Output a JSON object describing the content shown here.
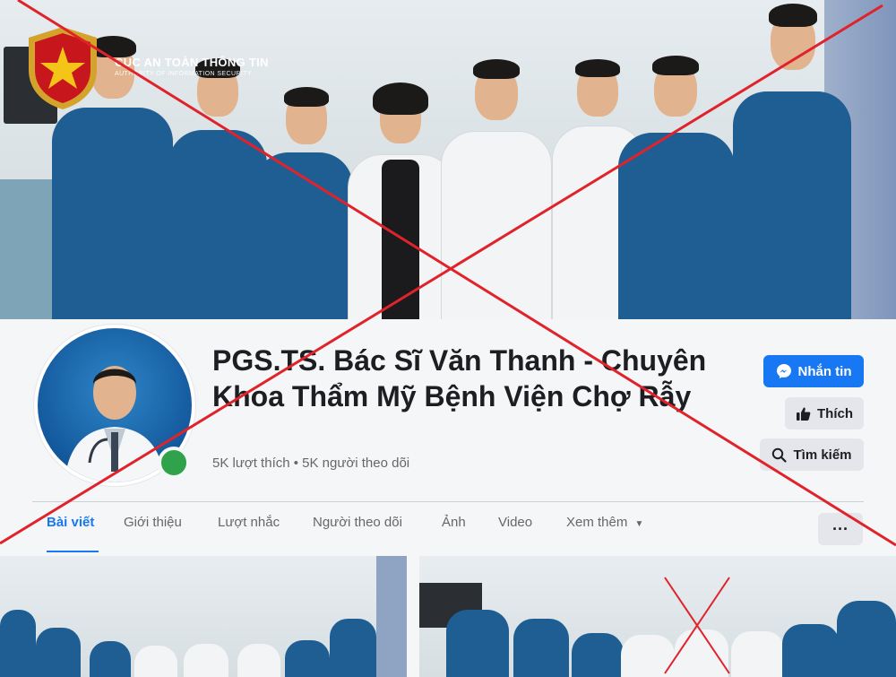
{
  "watermark": {
    "org_name": "CỤC AN TOÀN THÔNG TIN",
    "org_subtitle": "AUTHORITY OF INFORMATION SECURITY"
  },
  "profile": {
    "name": "PGS.TS. Bác Sĩ Văn Thanh - Chuyên Khoa Thẩm Mỹ Bệnh Viện Chợ Rẫy",
    "stats": "5K lượt thích • 5K người theo dõi"
  },
  "actions": {
    "message_label": "Nhắn tin",
    "like_label": "Thích",
    "search_label": "Tìm kiếm"
  },
  "tabs": {
    "items": [
      "Bài viết",
      "Giới thiệu",
      "Lượt nhắc",
      "Người theo dõi",
      "Ảnh",
      "Video",
      "Xem thêm"
    ],
    "active": "Bài viết",
    "more_button": "···"
  },
  "colors": {
    "brand_blue": "#1877f2",
    "scrub_blue": "#1f5e93",
    "cross_red": "#e0232b",
    "online_green": "#31a24c"
  },
  "icons": [
    "shield-star-logo",
    "messenger-icon",
    "thumbs-up-icon",
    "search-icon",
    "caret-down-icon",
    "ellipsis-icon"
  ]
}
